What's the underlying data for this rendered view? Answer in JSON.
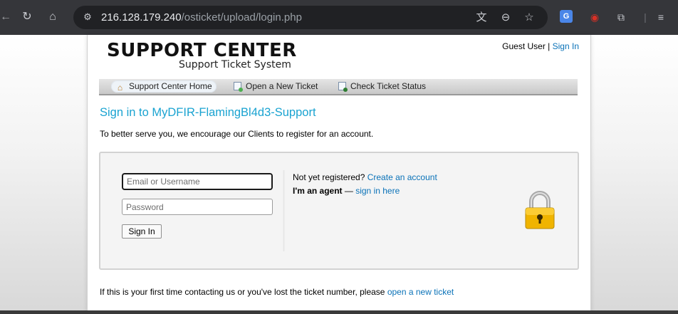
{
  "browser": {
    "url_host": "216.128.179.240",
    "url_path": "/osticket/upload/login.php"
  },
  "header": {
    "logo_title": "SUPPORT CENTER",
    "logo_subtitle": "Support Ticket System",
    "user_label": "Guest User",
    "separator": " | ",
    "sign_in_link": "Sign In"
  },
  "nav": {
    "items": [
      {
        "label": "Support Center Home",
        "icon": "home-icon",
        "active": true
      },
      {
        "label": "Open a New Ticket",
        "icon": "new-ticket-icon",
        "active": false
      },
      {
        "label": "Check Ticket Status",
        "icon": "ticket-status-icon",
        "active": false
      }
    ]
  },
  "main": {
    "heading": "Sign in to MyDFIR-FlamingBl4d3-Support",
    "intro": "To better serve you, we encourage our Clients to register for an account."
  },
  "login": {
    "email_placeholder": "Email or Username",
    "password_placeholder": "Password",
    "sign_in_button": "Sign In",
    "not_registered_text": "Not yet registered? ",
    "create_account_link": "Create an account",
    "agent_label": "I'm an agent",
    "agent_dash": " — ",
    "agent_sign_in_link": "sign in here",
    "lock_icon": "padlock-icon"
  },
  "footer": {
    "text": "If this is your first time contacting us or you've lost the ticket number, please ",
    "link": "open a new ticket"
  },
  "colors": {
    "link": "#0a72b8",
    "heading": "#1aa3d1",
    "chrome": "#35363a"
  }
}
